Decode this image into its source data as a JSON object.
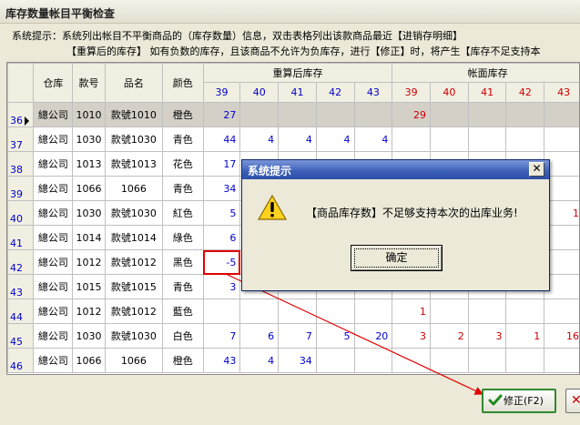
{
  "window": {
    "title": "库存数量帐目平衡检查"
  },
  "info": {
    "line1": "系统提示：系统列出帐目不平衡商品的（库存数量）信息，双击表格列出该款商品最近【进销存明细】",
    "line2": "【重算后的库存】 如有负数的库存，且该商品不允许为负库存，进行【修正】时，将产生【库存不足支持本"
  },
  "grid": {
    "group_headers": [
      "仓库",
      "款号",
      "品名",
      "颜色",
      "重算后库存",
      "帐面库存"
    ],
    "size_headers_recalc": [
      "39",
      "40",
      "41",
      "42",
      "43"
    ],
    "size_headers_book": [
      "39",
      "40",
      "41",
      "42",
      "43"
    ],
    "rows": [
      {
        "rn": "36",
        "wh": "總公司",
        "code": "1010",
        "name": "款號1010",
        "color": "橙色",
        "r": [
          "27",
          "",
          "",
          "",
          ""
        ],
        "b": [
          "29",
          "",
          "",
          "",
          ""
        ]
      },
      {
        "rn": "37",
        "wh": "總公司",
        "code": "1030",
        "name": "款號1030",
        "color": "青色",
        "r": [
          "44",
          "4",
          "4",
          "4",
          "4"
        ],
        "b": [
          "",
          "",
          "",
          "",
          ""
        ]
      },
      {
        "rn": "38",
        "wh": "總公司",
        "code": "1013",
        "name": "款號1013",
        "color": "花色",
        "r": [
          "17",
          "",
          "",
          "",
          ""
        ],
        "b": [
          "",
          "",
          "",
          "",
          ""
        ]
      },
      {
        "rn": "39",
        "wh": "總公司",
        "code": "1066",
        "name": "1066",
        "color": "青色",
        "r": [
          "34",
          "",
          "",
          "",
          ""
        ],
        "b": [
          "",
          "",
          "",
          "",
          ""
        ]
      },
      {
        "rn": "40",
        "wh": "總公司",
        "code": "1030",
        "name": "款號1030",
        "color": "紅色",
        "r": [
          "5",
          "",
          "",
          "",
          ""
        ],
        "b": [
          "",
          "",
          "",
          "",
          "1"
        ]
      },
      {
        "rn": "41",
        "wh": "總公司",
        "code": "1014",
        "name": "款號1014",
        "color": "綠色",
        "r": [
          "6",
          "",
          "",
          "",
          ""
        ],
        "b": [
          "",
          "",
          "",
          "",
          ""
        ]
      },
      {
        "rn": "42",
        "wh": "總公司",
        "code": "1012",
        "name": "款號1012",
        "color": "黑色",
        "r": [
          "-5",
          "",
          "",
          "",
          ""
        ],
        "b": [
          "",
          "",
          "",
          "",
          ""
        ]
      },
      {
        "rn": "43",
        "wh": "總公司",
        "code": "1015",
        "name": "款號1015",
        "color": "青色",
        "r": [
          "3",
          "",
          "",
          "",
          ""
        ],
        "b": [
          "",
          "",
          "",
          "",
          ""
        ]
      },
      {
        "rn": "44",
        "wh": "總公司",
        "code": "1012",
        "name": "款號1012",
        "color": "藍色",
        "r": [
          "",
          "",
          "",
          "",
          ""
        ],
        "b": [
          "1",
          "",
          "",
          "",
          ""
        ]
      },
      {
        "rn": "45",
        "wh": "總公司",
        "code": "1030",
        "name": "款號1030",
        "color": "白色",
        "r": [
          "7",
          "6",
          "7",
          "5",
          "20"
        ],
        "b": [
          "3",
          "2",
          "3",
          "1",
          "16"
        ]
      },
      {
        "rn": "46",
        "wh": "總公司",
        "code": "1066",
        "name": "1066",
        "color": "橙色",
        "r": [
          "43",
          "4",
          "34",
          "",
          ""
        ],
        "b": [
          "",
          "",
          "",
          "",
          ""
        ]
      }
    ]
  },
  "dialog": {
    "title": "系统提示",
    "message": "【商品库存数】不足够支持本次的出库业务!",
    "ok_label": "确定",
    "icon": "warning-icon"
  },
  "buttons": {
    "fix_label": "修正(F2)",
    "fix_icon": "checkmark-icon",
    "close_icon": "close-icon"
  },
  "colors": {
    "recalc_header": "#0000CC",
    "book_header": "#CC0000",
    "highlight": "#E00000",
    "dialog_caption": "#2D4FA8"
  }
}
